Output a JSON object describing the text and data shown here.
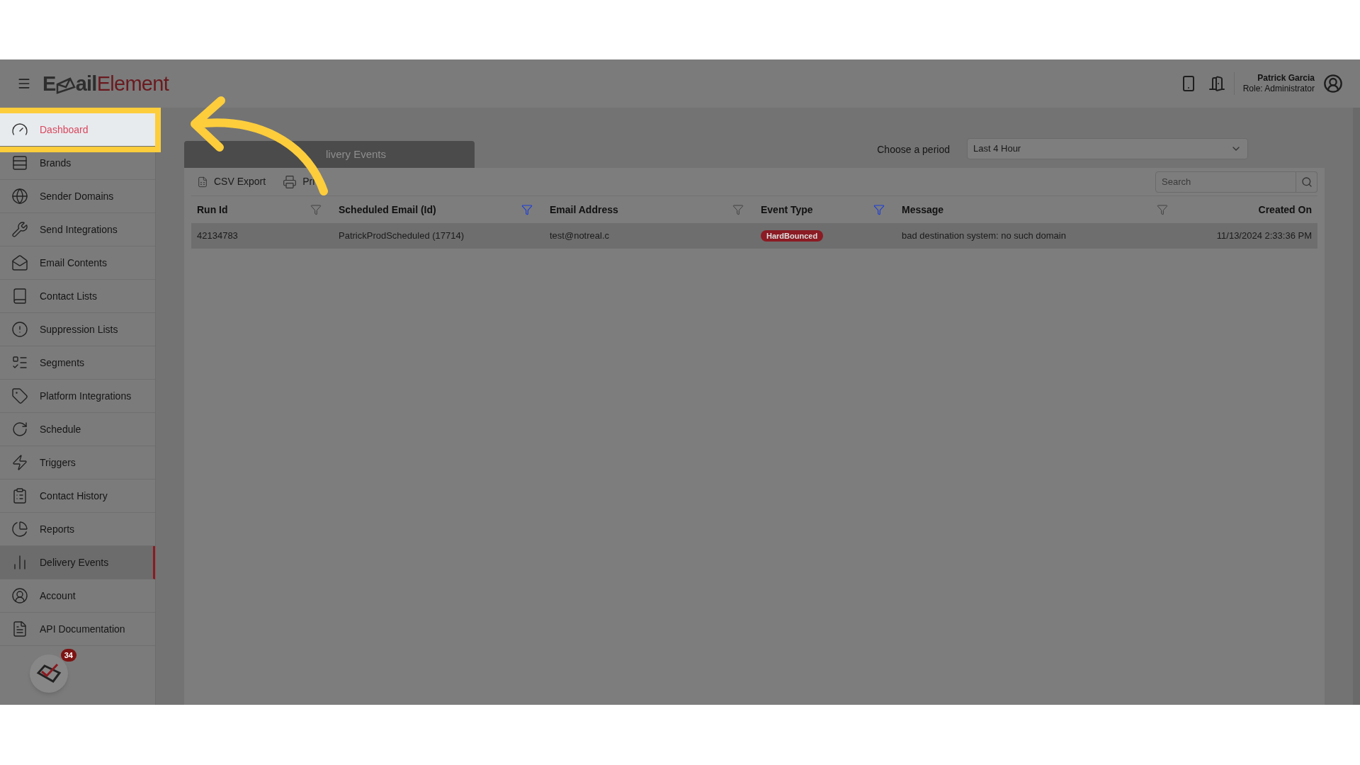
{
  "header": {
    "logo": [
      "E",
      "ail",
      "Element"
    ],
    "user": {
      "name": "Patrick Garcia",
      "role": "Role: Administrator"
    }
  },
  "sidebar": {
    "items": [
      {
        "label": "Dashboard",
        "selected": false,
        "highlighted": true
      },
      {
        "label": "Brands",
        "selected": false,
        "highlighted": false
      },
      {
        "label": "Sender Domains",
        "selected": false,
        "highlighted": false
      },
      {
        "label": "Send Integrations",
        "selected": false,
        "highlighted": false
      },
      {
        "label": "Email Contents",
        "selected": false,
        "highlighted": false
      },
      {
        "label": "Contact Lists",
        "selected": false,
        "highlighted": false
      },
      {
        "label": "Suppression Lists",
        "selected": false,
        "highlighted": false
      },
      {
        "label": "Segments",
        "selected": false,
        "highlighted": false
      },
      {
        "label": "Platform Integrations",
        "selected": false,
        "highlighted": false
      },
      {
        "label": "Schedule",
        "selected": false,
        "highlighted": false
      },
      {
        "label": "Triggers",
        "selected": false,
        "highlighted": false
      },
      {
        "label": "Contact History",
        "selected": false,
        "highlighted": false
      },
      {
        "label": "Reports",
        "selected": false,
        "highlighted": false
      },
      {
        "label": "Delivery Events",
        "selected": true,
        "highlighted": false
      },
      {
        "label": "Account",
        "selected": false,
        "highlighted": false
      },
      {
        "label": "API Documentation",
        "selected": false,
        "highlighted": false
      }
    ],
    "mail_badge": "34"
  },
  "panel": {
    "tab": "livery Events",
    "period_label": "Choose a period",
    "period": "Last 4 Hour",
    "toolbar": [
      "CSV Export",
      "Pri"
    ],
    "search": {
      "placeholder": "Search"
    },
    "table": {
      "columns": [
        {
          "label": "Run Id",
          "filter_active": false
        },
        {
          "label": "Scheduled Email (Id)",
          "filter_active": true
        },
        {
          "label": "Email Address",
          "filter_active": false
        },
        {
          "label": "Event Type",
          "filter_active": true
        },
        {
          "label": "Message",
          "filter_active": false
        },
        {
          "label": "Created On"
        }
      ],
      "rows": [
        {
          "cells": [
            "42134783",
            "PatrickProdScheduled (17714)",
            "test@notreal.c",
            "HardBounced",
            "bad destination system: no such domain",
            "11/13/2024 2:33:36 PM"
          ]
        }
      ]
    }
  }
}
